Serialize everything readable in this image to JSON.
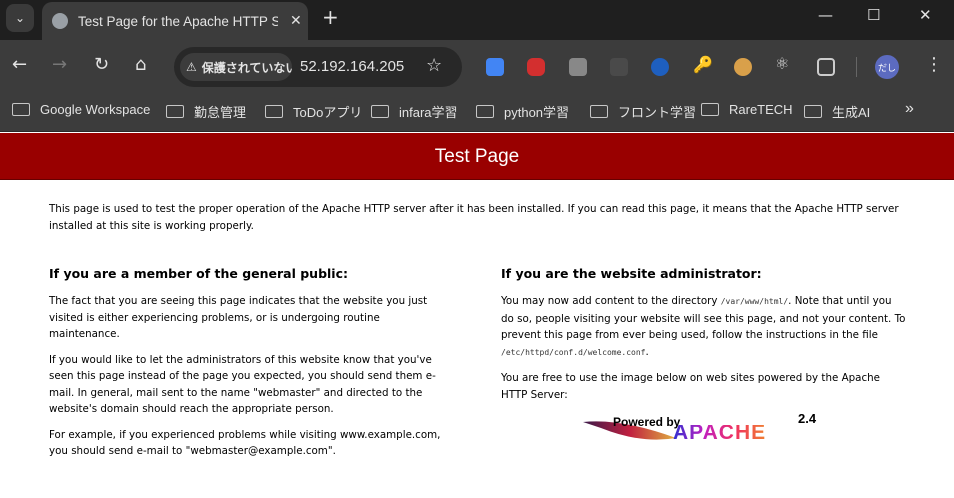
{
  "browser": {
    "tab_title": "Test Page for the Apache HTTP Server",
    "security_label": "保護されていない通信",
    "url": "52.192.164.205",
    "avatar_text": "だし",
    "extensions": [
      "google-translate",
      "youtube-fast",
      "line",
      "selenium",
      "web-globe",
      "key",
      "cookie",
      "react",
      "extensions-puzzle"
    ],
    "bookmarks": [
      "Google Workspace",
      "勤怠管理",
      "ToDoアプリ",
      "infara学習",
      "python学習",
      "フロント学習",
      "RareTECH",
      "生成AI"
    ],
    "more_bookmarks": "»"
  },
  "page": {
    "banner_title": "Test Page",
    "banner_color": "#990000",
    "intro": "This page is used to test the proper operation of the Apache HTTP server after it has been installed. If you can read this page, it means that the Apache HTTP server installed at this site is working properly.",
    "public": {
      "heading": "If you are a member of the general public:",
      "p1": "The fact that you are seeing this page indicates that the website you just visited is either experiencing problems, or is undergoing routine maintenance.",
      "p2": "If you would like to let the administrators of this website know that you've seen this page instead of the page you expected, you should send them e-mail. In general, mail sent to the name \"webmaster\" and directed to the website's domain should reach the appropriate person.",
      "p3": "For example, if you experienced problems while visiting www.example.com, you should send e-mail to \"webmaster@example.com\"."
    },
    "admin": {
      "heading": "If you are the website administrator:",
      "p1_a": "You may now add content to the directory ",
      "p1_code1": "/var/www/html/",
      "p1_b": ". Note that until you do so, people visiting your website will see this page, and not your content. To prevent this page from ever being used, follow the instructions in the file ",
      "p1_code2": "/etc/httpd/conf.d/welcome.conf",
      "p1_c": ".",
      "p2": "You are free to use the image below on web sites powered by the Apache HTTP Server:",
      "logo": {
        "powered_by": "Powered by",
        "name": "APACHE",
        "version": "2.4"
      }
    }
  }
}
